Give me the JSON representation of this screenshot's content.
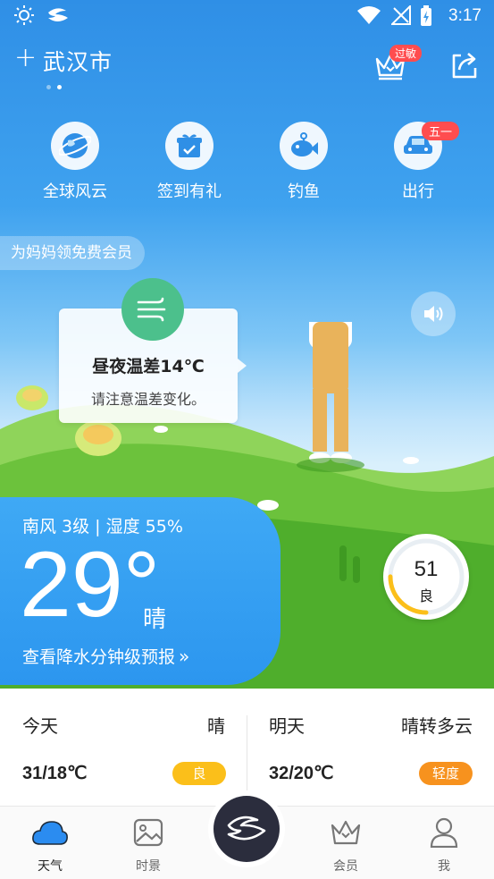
{
  "status_bar": {
    "time": "3:17"
  },
  "header": {
    "city": "武汉市",
    "add_symbol": "+",
    "allergy_badge": "过敏"
  },
  "quick_entries": [
    {
      "label": "全球风云",
      "icon": "globe-icon"
    },
    {
      "label": "签到有礼",
      "icon": "gift-icon"
    },
    {
      "label": "钓鱼",
      "icon": "fish-icon"
    },
    {
      "label": "出行",
      "icon": "car-icon",
      "badge": "五一"
    }
  ],
  "promo": {
    "text": "为妈妈领免费会员"
  },
  "tip": {
    "title": "昼夜温差14℃",
    "body": "请注意温差变化。",
    "icon": "wind-icon"
  },
  "current": {
    "wind_humidity": "南风 3级 | 湿度 55%",
    "temperature": "29°",
    "condition": "晴",
    "precip_link": "查看降水分钟级预报",
    "precip_arrow": "»"
  },
  "aqi": {
    "value": "51",
    "level": "良",
    "fraction": 0.25,
    "color": "#fbbf1a"
  },
  "forecast": [
    {
      "day": "今天",
      "condition": "晴",
      "range": "31/18℃",
      "aqi_level": "良",
      "badge_color": "#fbbf1a"
    },
    {
      "day": "明天",
      "condition": "晴转多云",
      "range": "32/20℃",
      "aqi_level": "轻度",
      "badge_color": "#f7921e"
    }
  ],
  "nav": [
    {
      "label": "天气",
      "icon": "cloud-icon",
      "active": true
    },
    {
      "label": "时景",
      "icon": "image-icon",
      "active": false
    },
    {
      "label": "会员",
      "icon": "crown-icon",
      "active": false
    },
    {
      "label": "我",
      "icon": "person-icon",
      "active": false
    }
  ],
  "colors": {
    "accent": "#2c96ef",
    "nav_active": "#2b8cf0",
    "badge_red": "#ff4d4f"
  }
}
